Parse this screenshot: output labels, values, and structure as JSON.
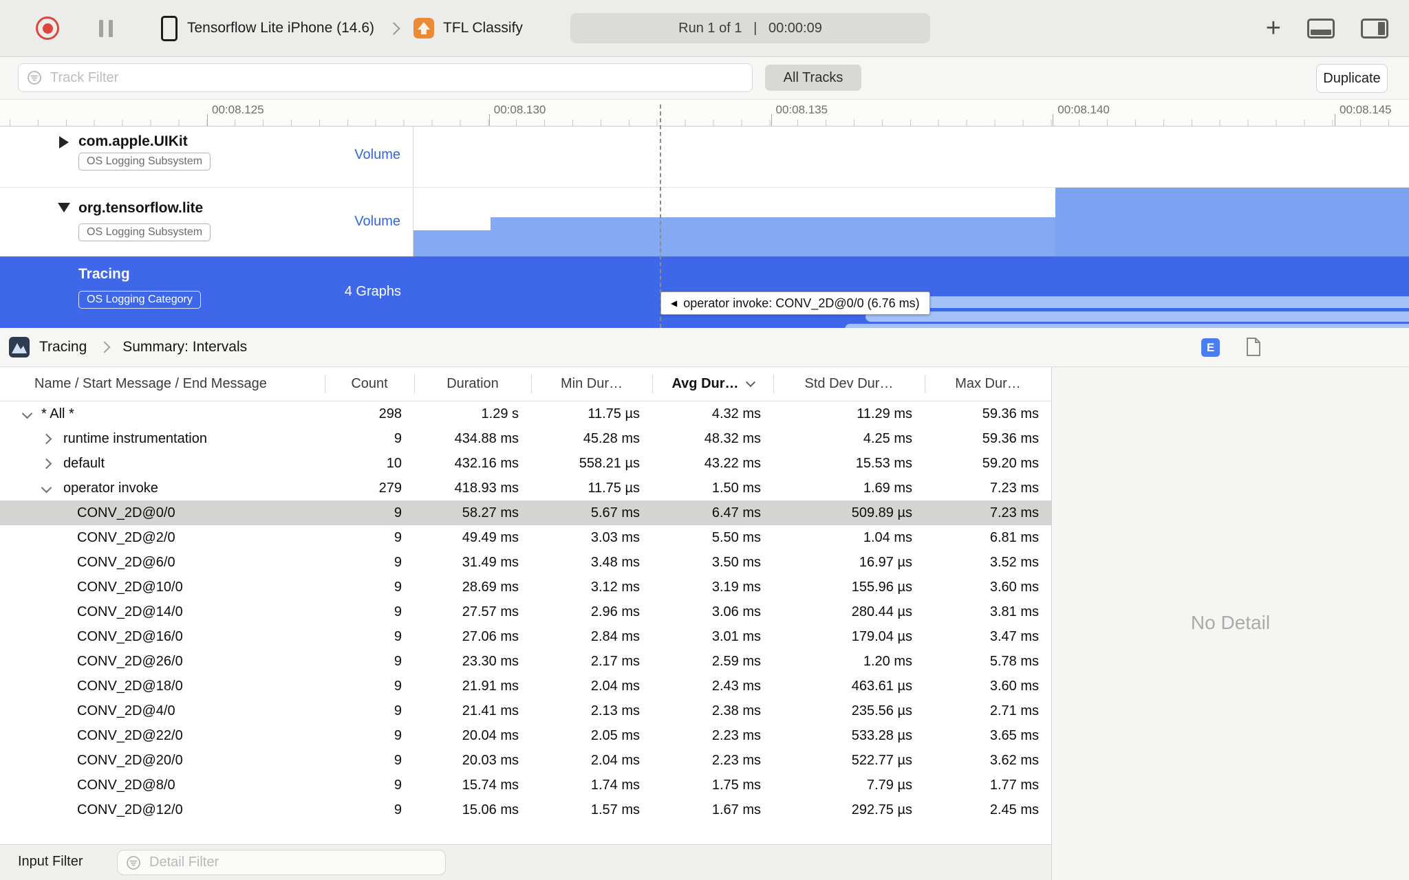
{
  "toolbar": {
    "device_name": "Tensorflow Lite iPhone (14.6)",
    "app_name": "TFL Classify",
    "run_status": "Run 1 of 1   |   00:00:09"
  },
  "filter_bar": {
    "track_filter_placeholder": "Track Filter",
    "all_tracks_label": "All Tracks",
    "duplicate_label": "Duplicate"
  },
  "ruler": {
    "labels": [
      "00:08.125",
      "00:08.130",
      "00:08.135",
      "00:08.140",
      "00:08.145"
    ]
  },
  "tracks": [
    {
      "name": "com.apple.UIKit",
      "badge": "OS Logging Subsystem",
      "right_label": "Volume"
    },
    {
      "name": "org.tensorflow.lite",
      "badge": "OS Logging Subsystem",
      "right_label": "Volume"
    },
    {
      "name": "Tracing",
      "badge": "OS Logging Category",
      "right_label": "4 Graphs"
    }
  ],
  "tooltip": {
    "text": "operator invoke: CONV_2D@0/0 (6.76 ms)"
  },
  "pane_header": {
    "breadcrumb_root": "Tracing",
    "breadcrumb_view": "Summary: Intervals",
    "extended_detail_badge": "E"
  },
  "table": {
    "columns": [
      "Name / Start Message / End Message",
      "Count",
      "Duration",
      "Min Dur…",
      "Avg Dur…",
      "Std Dev Dur…",
      "Max Dur…"
    ],
    "sorted_column_index": 4,
    "rows": [
      {
        "name": "* All *",
        "count": "298",
        "duration": "1.29 s",
        "min": "11.75 µs",
        "avg": "4.32 ms",
        "std": "11.29 ms",
        "max": "59.36 ms",
        "level": 0,
        "disclosure": "open",
        "selected": false
      },
      {
        "name": "runtime instrumentation",
        "count": "9",
        "duration": "434.88 ms",
        "min": "45.28 ms",
        "avg": "48.32 ms",
        "std": "4.25 ms",
        "max": "59.36 ms",
        "level": 1,
        "disclosure": "closed",
        "selected": false
      },
      {
        "name": "default",
        "count": "10",
        "duration": "432.16 ms",
        "min": "558.21 µs",
        "avg": "43.22 ms",
        "std": "15.53 ms",
        "max": "59.20 ms",
        "level": 1,
        "disclosure": "closed",
        "selected": false
      },
      {
        "name": "operator invoke",
        "count": "279",
        "duration": "418.93 ms",
        "min": "11.75 µs",
        "avg": "1.50 ms",
        "std": "1.69 ms",
        "max": "7.23 ms",
        "level": 1,
        "disclosure": "open",
        "selected": false
      },
      {
        "name": "CONV_2D@0/0",
        "count": "9",
        "duration": "58.27 ms",
        "min": "5.67 ms",
        "avg": "6.47 ms",
        "std": "509.89 µs",
        "max": "7.23 ms",
        "level": 2,
        "disclosure": "none",
        "selected": true
      },
      {
        "name": "CONV_2D@2/0",
        "count": "9",
        "duration": "49.49 ms",
        "min": "3.03 ms",
        "avg": "5.50 ms",
        "std": "1.04 ms",
        "max": "6.81 ms",
        "level": 2,
        "disclosure": "none",
        "selected": false
      },
      {
        "name": "CONV_2D@6/0",
        "count": "9",
        "duration": "31.49 ms",
        "min": "3.48 ms",
        "avg": "3.50 ms",
        "std": "16.97 µs",
        "max": "3.52 ms",
        "level": 2,
        "disclosure": "none",
        "selected": false
      },
      {
        "name": "CONV_2D@10/0",
        "count": "9",
        "duration": "28.69 ms",
        "min": "3.12 ms",
        "avg": "3.19 ms",
        "std": "155.96 µs",
        "max": "3.60 ms",
        "level": 2,
        "disclosure": "none",
        "selected": false
      },
      {
        "name": "CONV_2D@14/0",
        "count": "9",
        "duration": "27.57 ms",
        "min": "2.96 ms",
        "avg": "3.06 ms",
        "std": "280.44 µs",
        "max": "3.81 ms",
        "level": 2,
        "disclosure": "none",
        "selected": false
      },
      {
        "name": "CONV_2D@16/0",
        "count": "9",
        "duration": "27.06 ms",
        "min": "2.84 ms",
        "avg": "3.01 ms",
        "std": "179.04 µs",
        "max": "3.47 ms",
        "level": 2,
        "disclosure": "none",
        "selected": false
      },
      {
        "name": "CONV_2D@26/0",
        "count": "9",
        "duration": "23.30 ms",
        "min": "2.17 ms",
        "avg": "2.59 ms",
        "std": "1.20 ms",
        "max": "5.78 ms",
        "level": 2,
        "disclosure": "none",
        "selected": false
      },
      {
        "name": "CONV_2D@18/0",
        "count": "9",
        "duration": "21.91 ms",
        "min": "2.04 ms",
        "avg": "2.43 ms",
        "std": "463.61 µs",
        "max": "3.60 ms",
        "level": 2,
        "disclosure": "none",
        "selected": false
      },
      {
        "name": "CONV_2D@4/0",
        "count": "9",
        "duration": "21.41 ms",
        "min": "2.13 ms",
        "avg": "2.38 ms",
        "std": "235.56 µs",
        "max": "2.71 ms",
        "level": 2,
        "disclosure": "none",
        "selected": false
      },
      {
        "name": "CONV_2D@22/0",
        "count": "9",
        "duration": "20.04 ms",
        "min": "2.05 ms",
        "avg": "2.23 ms",
        "std": "533.28 µs",
        "max": "3.65 ms",
        "level": 2,
        "disclosure": "none",
        "selected": false
      },
      {
        "name": "CONV_2D@20/0",
        "count": "9",
        "duration": "20.03 ms",
        "min": "2.04 ms",
        "avg": "2.23 ms",
        "std": "522.77 µs",
        "max": "3.62 ms",
        "level": 2,
        "disclosure": "none",
        "selected": false
      },
      {
        "name": "CONV_2D@8/0",
        "count": "9",
        "duration": "15.74 ms",
        "min": "1.74 ms",
        "avg": "1.75 ms",
        "std": "7.79 µs",
        "max": "1.77 ms",
        "level": 2,
        "disclosure": "none",
        "selected": false
      },
      {
        "name": "CONV_2D@12/0",
        "count": "9",
        "duration": "15.06 ms",
        "min": "1.57 ms",
        "avg": "1.67 ms",
        "std": "292.75 µs",
        "max": "2.45 ms",
        "level": 2,
        "disclosure": "none",
        "selected": false
      }
    ]
  },
  "detail_panel": {
    "empty_text": "No Detail"
  },
  "bottom_bar": {
    "label": "Input Filter",
    "detail_filter_placeholder": "Detail Filter"
  }
}
